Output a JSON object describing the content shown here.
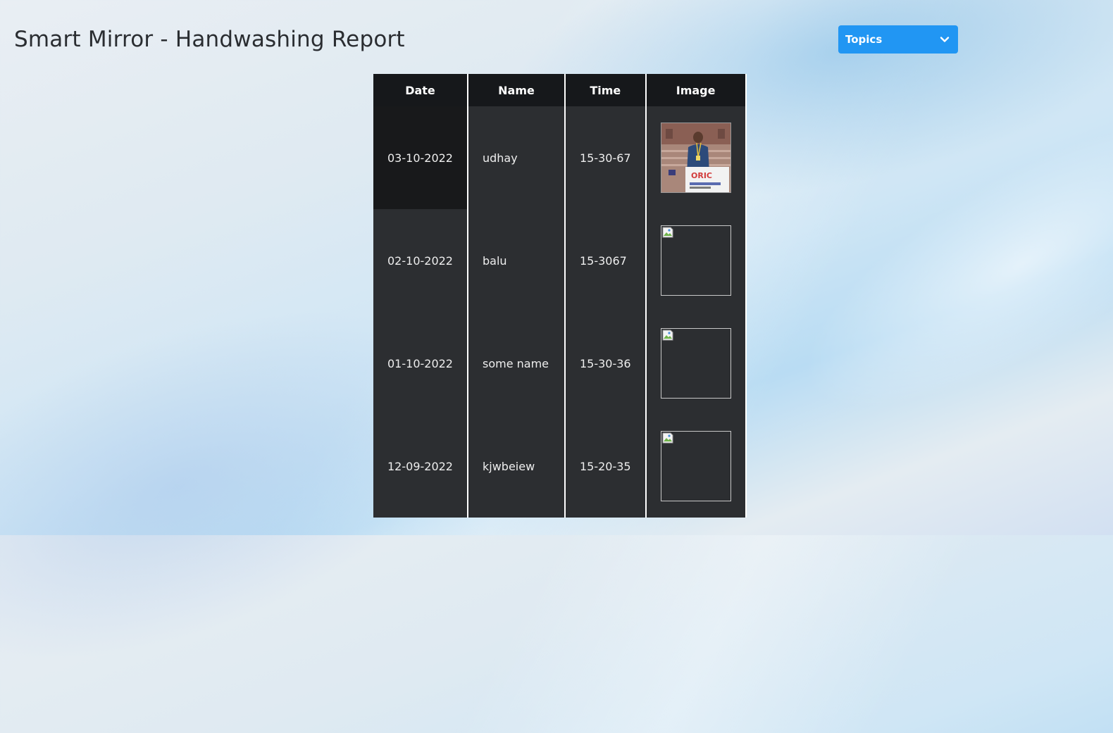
{
  "header": {
    "title": "Smart Mirror - Handwashing Report"
  },
  "topics_select": {
    "label": "Topics",
    "icon": "chevron-down-icon",
    "color": "#2196f3"
  },
  "table": {
    "columns": [
      "Date",
      "Name",
      "Time",
      "Image"
    ],
    "rows": [
      {
        "date": "03-10-2022",
        "name": "udhay",
        "time": "15-30-67",
        "image": "photo"
      },
      {
        "date": "02-10-2022",
        "name": "balu",
        "time": "15-3067",
        "image": "broken-image-icon"
      },
      {
        "date": "01-10-2022",
        "name": "some name",
        "time": "15-30-36",
        "image": "broken-image-icon"
      },
      {
        "date": "12-09-2022",
        "name": "kjwbeiew",
        "time": "15-20-35",
        "image": "broken-image-icon"
      }
    ]
  }
}
